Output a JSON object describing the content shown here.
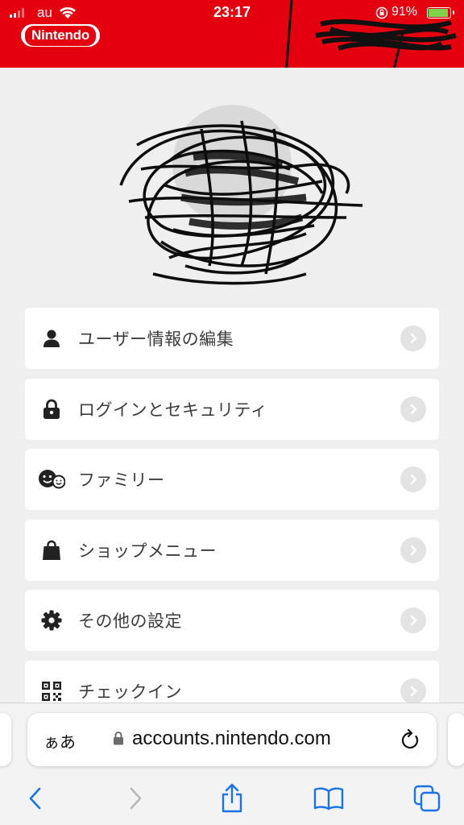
{
  "status_bar": {
    "carrier": "au",
    "time": "23:17",
    "battery_percent": "91%"
  },
  "header": {
    "logo_text": "Nintendo",
    "brand_color": "#e4000f"
  },
  "profile": {
    "username": ""
  },
  "menu": {
    "items": [
      {
        "label": "ユーザー情報の編集",
        "icon": "person-icon"
      },
      {
        "label": "ログインとセキュリティ",
        "icon": "lock-icon"
      },
      {
        "label": "ファミリー",
        "icon": "family-icon"
      },
      {
        "label": "ショップメニュー",
        "icon": "shopping-bag-icon"
      },
      {
        "label": "その他の設定",
        "icon": "gear-icon"
      },
      {
        "label": "チェックイン",
        "icon": "qr-code-icon"
      }
    ]
  },
  "browser": {
    "text_size_button": "ぁあ",
    "url": "accounts.nintendo.com"
  }
}
